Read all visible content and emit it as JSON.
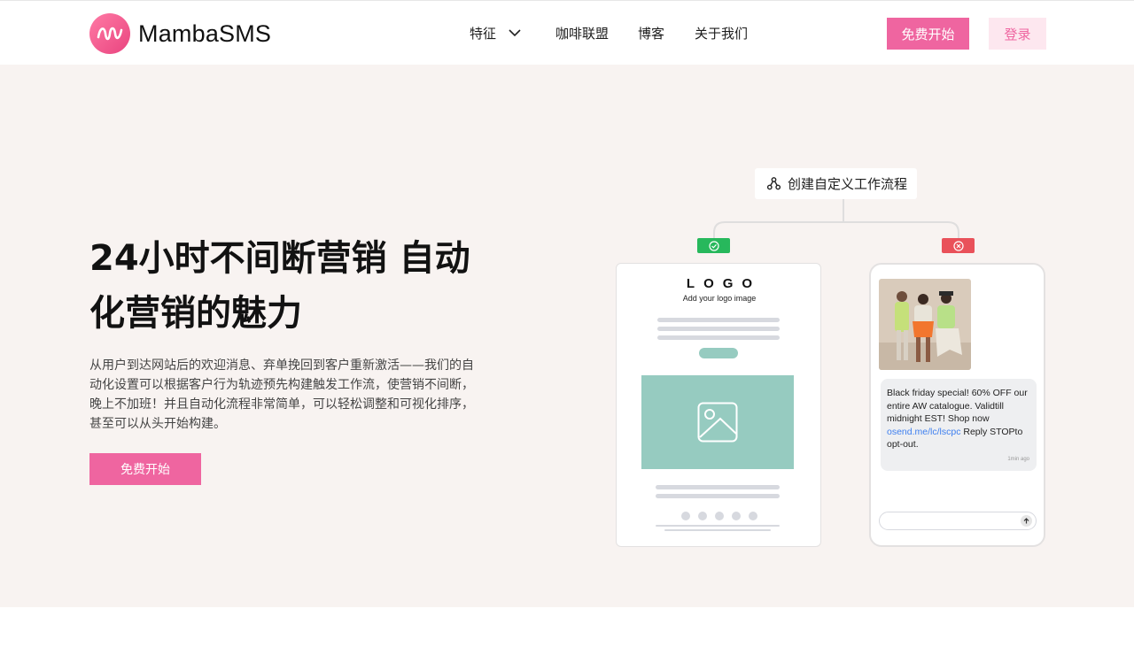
{
  "brand": {
    "name": "MambaSMS",
    "accent": "#ef65a0",
    "accent_light": "#fde7ef"
  },
  "nav": {
    "features": "特征",
    "affiliate": "咖啡联盟",
    "blog": "博客",
    "about": "关于我们"
  },
  "header_actions": {
    "start": "免费开始",
    "login": "登录"
  },
  "hero": {
    "title": "24小时不间断营销 自动化营销的魅力",
    "description": "从用户到达网站后的欢迎消息、弃单挽回到客户重新激活——我们的自动化设置可以根据客户行为轨迹预先构建触发工作流，使营销不间断，晚上不加班！并且自动化流程非常简单，可以轻松调整和可视化排序，甚至可以从头开始构建。",
    "cta": "免费开始"
  },
  "illustration": {
    "workflow_label": "创建自定义工作流程",
    "email": {
      "logo": "LOGO",
      "logo_hint": "Add your logo image"
    },
    "sms": {
      "text_before": "Black friday special! 60% OFF our entire AW catalogue. Validtill midnight EST! Shop now ",
      "link": "osend.me/lc/lscpc",
      "text_after": " Reply STOPto opt-out.",
      "time": "1min ago"
    }
  }
}
